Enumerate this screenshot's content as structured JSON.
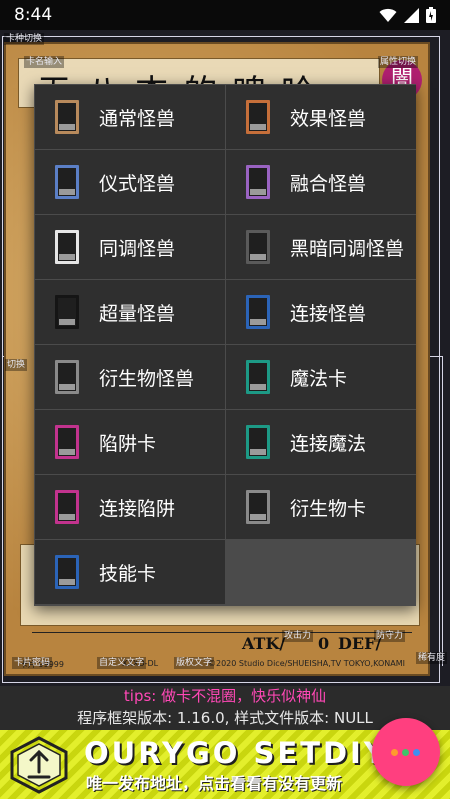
{
  "status_bar": {
    "time": "8:44"
  },
  "editor": {
    "labels": {
      "card_type_toggle": "卡种切换",
      "card_name_input": "卡名输入",
      "attribute_toggle": "属性切换",
      "switch_frame": "切换 ",
      "defense_label": "防守力",
      "attack_label": "攻击力",
      "password_label": "卡片密码",
      "custom_text": "自定义文字",
      "copyright": "版权文字",
      "rarity": "稀有度"
    },
    "card": {
      "title": "无 八 杰 的 啤 哈",
      "attribute": "闇",
      "atk_label": "ATK",
      "atk_value": "0",
      "def_label": "DEF",
      "password": "卡片 99999",
      "set_code": "XXXD-DL",
      "copyright_text": "©2020 Studio Dice/SHUEISHA,TV TOKYO,KONAMI"
    }
  },
  "type_menu": {
    "items": [
      {
        "label": "通常怪兽",
        "color": "#b88a5c"
      },
      {
        "label": "效果怪兽",
        "color": "#c66f3a"
      },
      {
        "label": "仪式怪兽",
        "color": "#5b7fc6"
      },
      {
        "label": "融合怪兽",
        "color": "#9a63c2"
      },
      {
        "label": "同调怪兽",
        "color": "#e6e6e6"
      },
      {
        "label": "黑暗同调怪兽",
        "color": "#5a5a5a"
      },
      {
        "label": "超量怪兽",
        "color": "#151515"
      },
      {
        "label": "连接怪兽",
        "color": "#2b64b8"
      },
      {
        "label": "衍生物怪兽",
        "color": "#8a8a8a"
      },
      {
        "label": "魔法卡",
        "color": "#1d9a86"
      },
      {
        "label": "陷阱卡",
        "color": "#c2338e"
      },
      {
        "label": "连接魔法",
        "color": "#1d9a86"
      },
      {
        "label": "连接陷阱",
        "color": "#c2338e"
      },
      {
        "label": "衍生物卡",
        "color": "#8a8a8a"
      },
      {
        "label": "技能卡",
        "color": "#2b64b8"
      }
    ]
  },
  "footer": {
    "tips": "tips: 做卡不混圈，快乐似神仙",
    "version": "程序框架版本: 1.16.0, 样式文件版本: NULL"
  },
  "banner": {
    "title": "OURYGO SETDIY",
    "subtitle": "唯一发布地址，点击看看有没有更新"
  },
  "fab": {
    "icon": "more-dots-icon",
    "dot_colors": [
      "#ff9a2e",
      "#3fc36a",
      "#3f8ff0"
    ]
  }
}
